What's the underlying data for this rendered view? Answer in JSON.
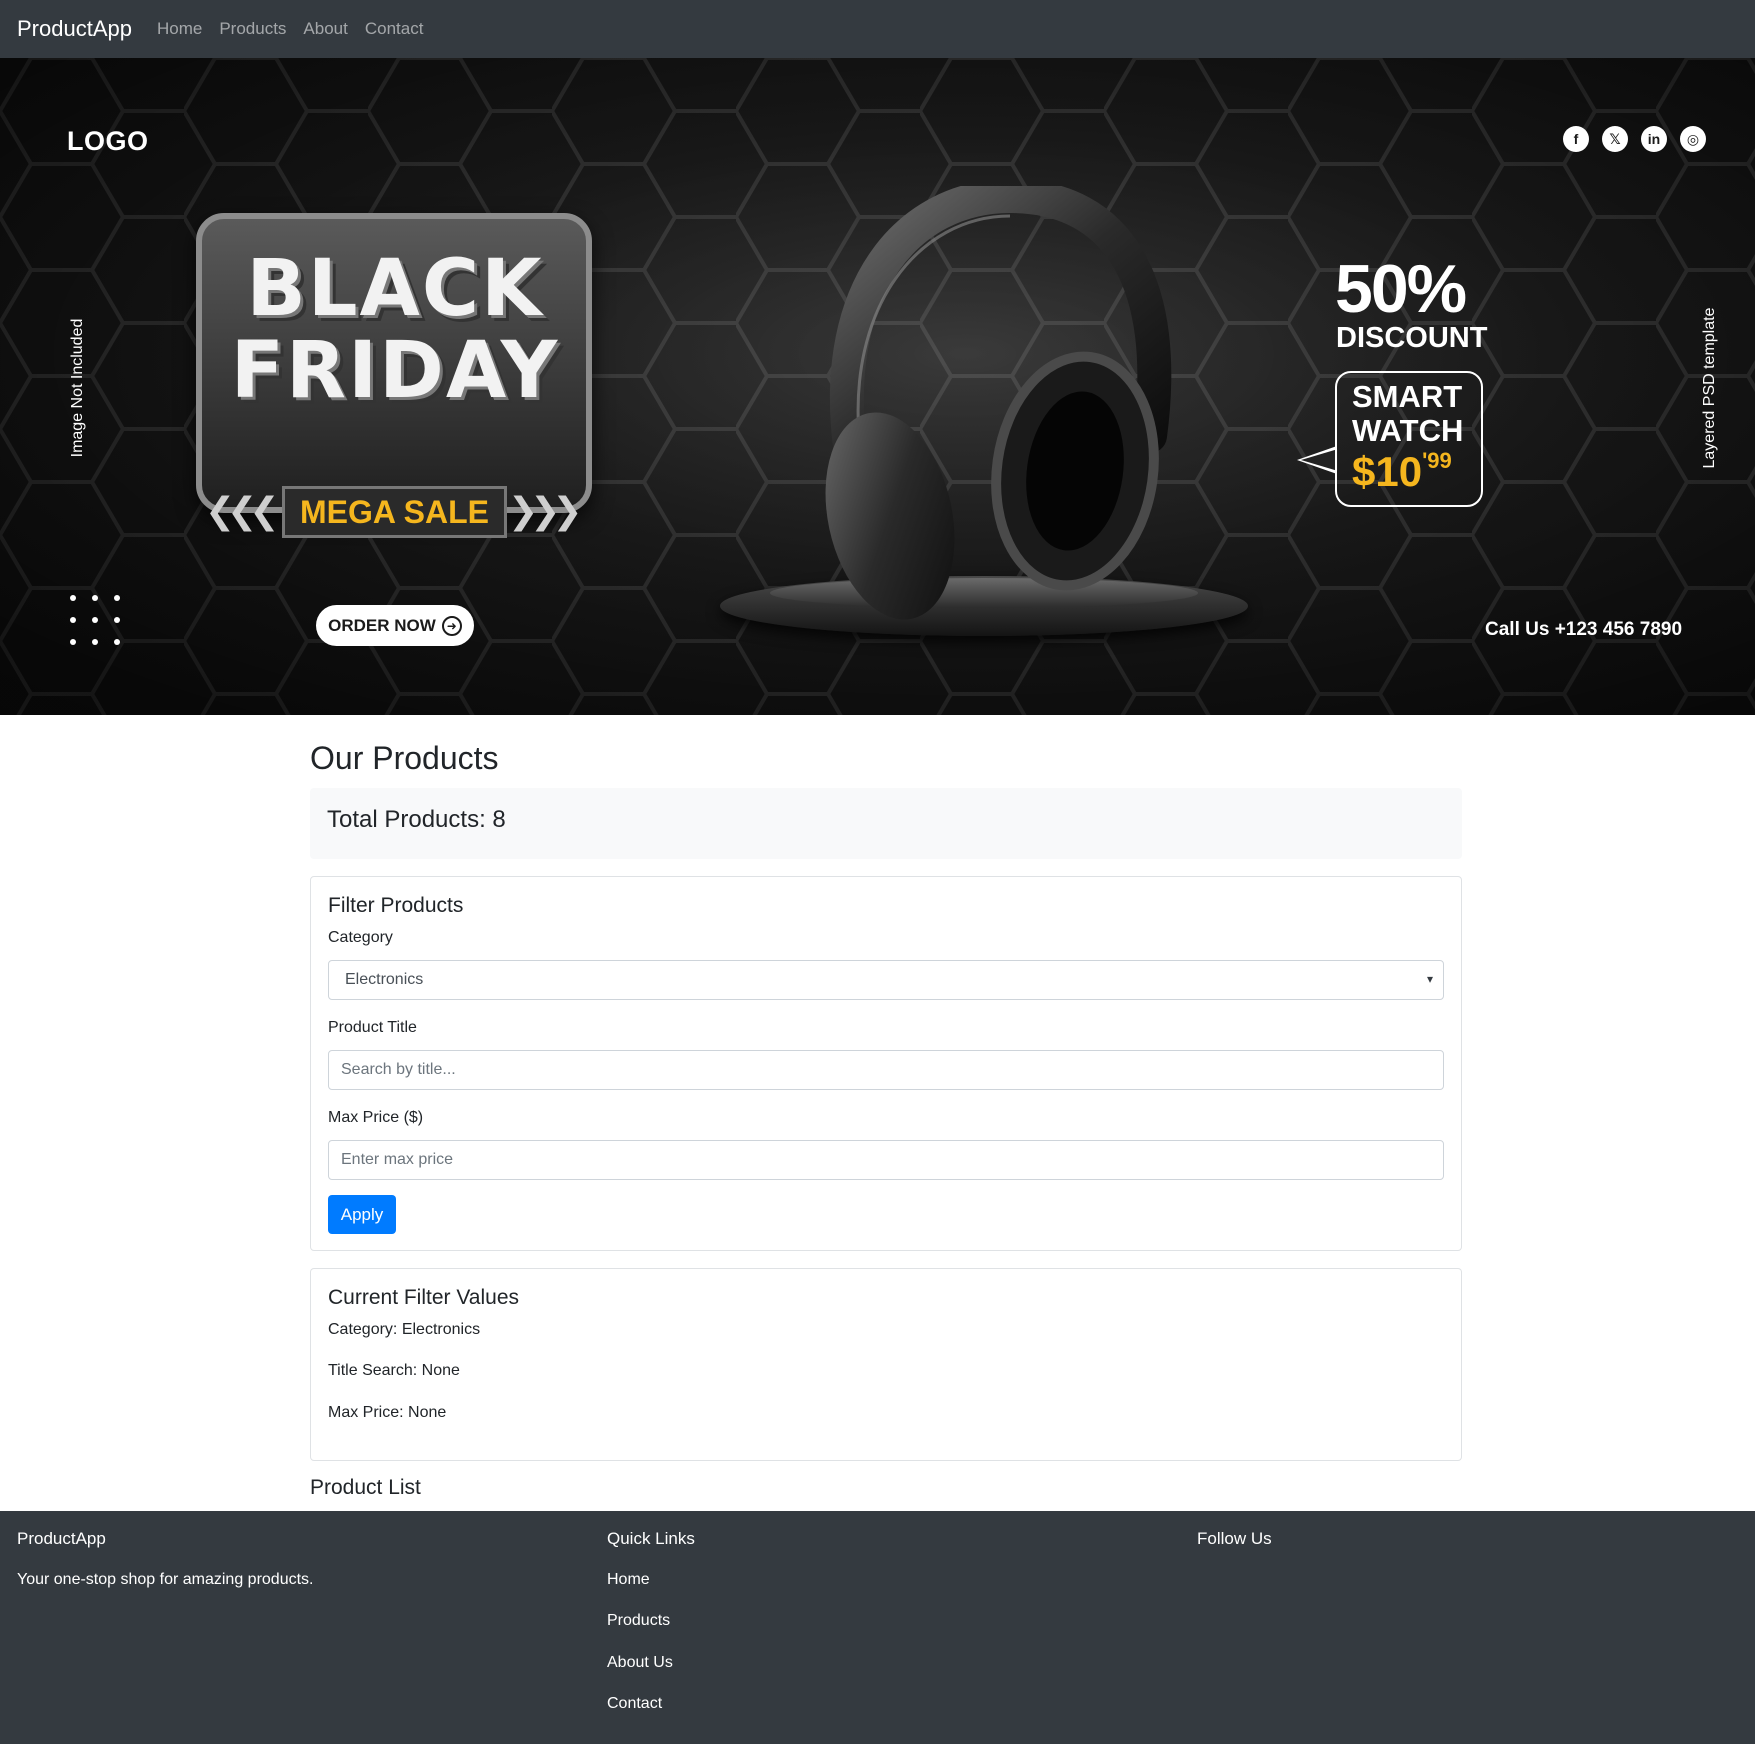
{
  "navbar": {
    "brand": "ProductApp",
    "links": [
      "Home",
      "Products",
      "About",
      "Contact"
    ]
  },
  "banner": {
    "logo": "LOGO",
    "left_vertical": "Image Not Included",
    "right_vertical": "Layered  PSD template",
    "headline_line1": "BLACK",
    "headline_line2": "FRIDAY",
    "tag": "MEGA SALE",
    "cta": "ORDER NOW",
    "discount_pct": "50%",
    "discount_label": "DISCOUNT",
    "product_line1": "SMART",
    "product_line2": "WATCH",
    "price_main": "$10",
    "price_cents": "'99",
    "phone": "Call Us +123 456 7890",
    "social": [
      {
        "icon": "facebook-icon",
        "glyph": "f"
      },
      {
        "icon": "x-twitter-icon",
        "glyph": "𝕏"
      },
      {
        "icon": "linkedin-icon",
        "glyph": "in"
      },
      {
        "icon": "instagram-icon",
        "glyph": "◎"
      }
    ],
    "accent_color": "#f5b61e"
  },
  "main": {
    "title": "Our Products",
    "total_products": "Total Products: 8",
    "filter": {
      "heading": "Filter Products",
      "category_label": "Category",
      "category_value": "Electronics",
      "title_label": "Product Title",
      "title_placeholder": "Search by title...",
      "price_label": "Max Price ($)",
      "price_placeholder": "Enter max price",
      "apply_label": "Apply"
    },
    "current": {
      "heading": "Current Filter Values",
      "category": "Category: Electronics",
      "title_search": "Title Search: None",
      "max_price": "Max Price: None"
    },
    "product_list_heading": "Product List"
  },
  "footer": {
    "brand": "ProductApp",
    "tagline": "Your one-stop shop for amazing products.",
    "quick_links_heading": "Quick Links",
    "links": [
      "Home",
      "Products",
      "About Us",
      "Contact"
    ],
    "follow_heading": "Follow Us"
  },
  "colors": {
    "navbar_bg": "#343a40",
    "primary": "#007bff",
    "light_bg": "#f8f9fa"
  }
}
